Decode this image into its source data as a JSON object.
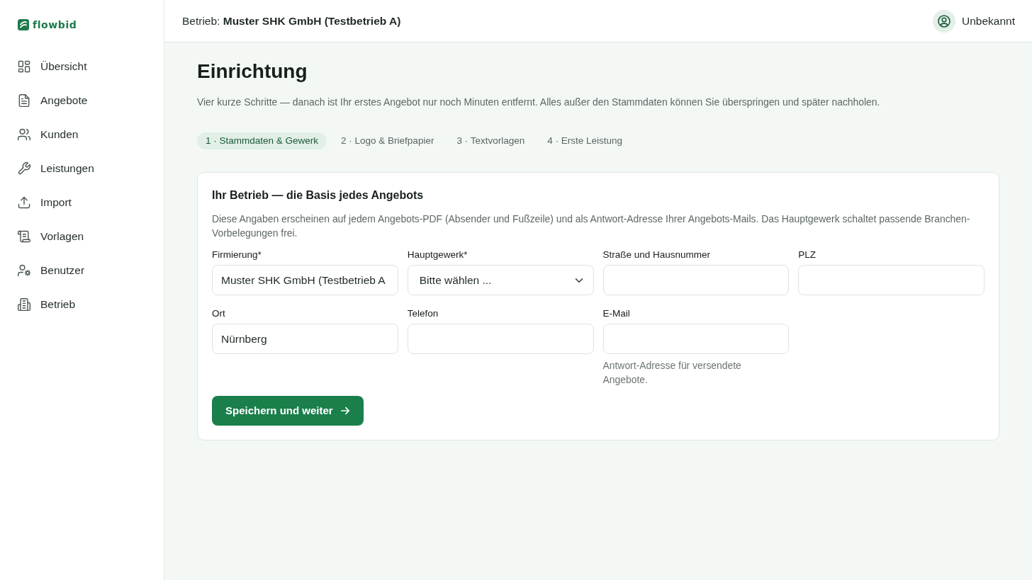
{
  "sidebar": {
    "brand": "flowbid",
    "items": [
      {
        "label": "Übersicht"
      },
      {
        "label": "Angebote"
      },
      {
        "label": "Kunden"
      },
      {
        "label": "Leistungen"
      },
      {
        "label": "Import"
      },
      {
        "label": "Vorlagen"
      },
      {
        "label": "Benutzer"
      },
      {
        "label": "Betrieb"
      }
    ]
  },
  "header": {
    "business": "Betrieb: **Muster SHK GmbH (Testbetrieb A)**",
    "user": "Unbekannt"
  },
  "page": {
    "title": "Einrichtung",
    "intro": "Vier kurze Schritte — danach ist Ihr erstes Angebot nur noch Minuten entfernt. Alles außer den Stammdaten können Sie überspringen und später nachholen."
  },
  "steps": [
    {
      "label": "1 · Stammdaten & Gewerk",
      "selected": true
    },
    {
      "label": "2 · Logo & Briefpapier",
      "selected": false
    },
    {
      "label": "3 · Textvorlagen",
      "selected": false
    },
    {
      "label": "4 · Erste Leistung",
      "selected": false
    }
  ],
  "form": {
    "title": "Ihr Betrieb — die Basis jedes Angebots",
    "description": "Diese Angaben erscheinen auf jedem Angebots-PDF (Absender und Fußzeile) und als Antwort-Adresse Ihrer Angebots-Mails. Das Hauptgewerk schaltet passende Branchen-Vorbelegungen frei.",
    "fields": [
      {
        "kind": "text",
        "label": "Firmierung*",
        "value": "Muster SHK GmbH (Testbetrieb A"
      },
      {
        "kind": "select",
        "label": "Hauptgewerk*",
        "value": "Bitte wählen ..."
      },
      {
        "kind": "text",
        "label": "Straße und Hausnummer"
      },
      {
        "kind": "text",
        "label": "PLZ"
      },
      {
        "kind": "text",
        "label": "Ort",
        "value": "Nürnberg"
      },
      {
        "kind": "text",
        "label": "Telefon"
      },
      {
        "kind": "text",
        "label": "E-Mail",
        "help": "Antwort-Adresse für versendete Angebote."
      }
    ],
    "submit": "Speichern und weiter"
  }
}
